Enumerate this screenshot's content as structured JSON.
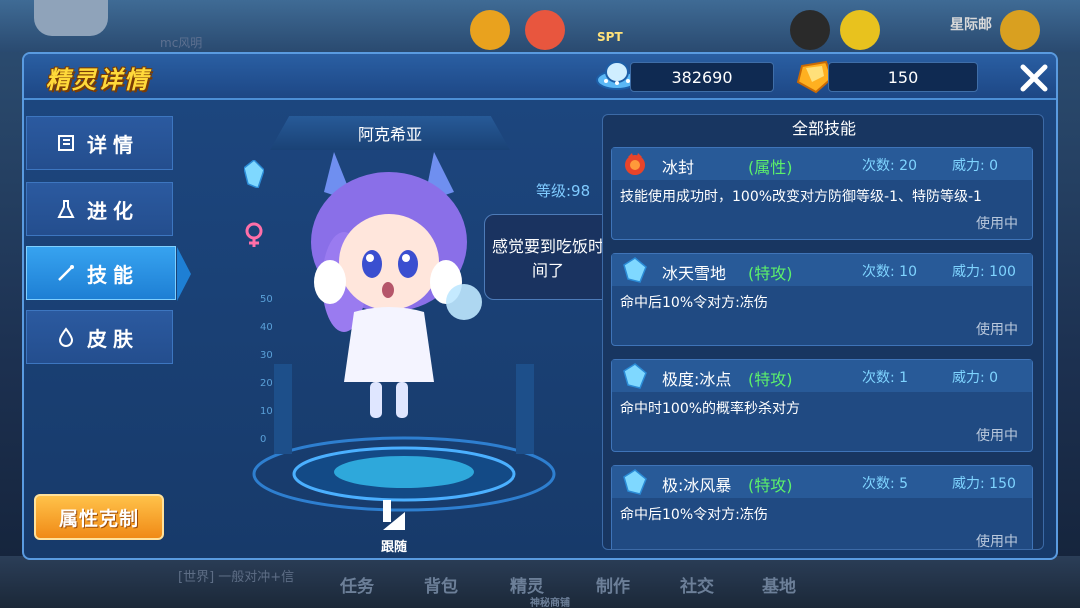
{
  "background": {
    "chat_top": "mc风明",
    "mail_label": "星际邮",
    "spt_label": "SPT",
    "chat_bottom": "[世界] 一般对冲+信",
    "bottom_nav": [
      "任务",
      "背包",
      "精灵",
      "制作",
      "社交",
      "基地"
    ],
    "bottom_sub": "神秘商铺"
  },
  "header": {
    "title": "精灵详情",
    "currency1_value": "382690",
    "currency2_value": "150",
    "close_icon": "close-icon"
  },
  "sidebar": {
    "tabs": [
      {
        "label": "详情",
        "icon": "book-icon"
      },
      {
        "label": "进化",
        "icon": "flask-icon"
      },
      {
        "label": "技能",
        "icon": "wand-icon"
      },
      {
        "label": "皮肤",
        "icon": "drop-icon"
      }
    ],
    "active_tab": "技能",
    "attribute_button": "属性克制"
  },
  "pet": {
    "name": "阿克希亚",
    "level_text": "等级:98",
    "speech": "感觉要到吃饭时间了",
    "follow_label": "跟随",
    "scale_ticks": [
      "50",
      "40",
      "30",
      "20",
      "10",
      "0"
    ]
  },
  "skills": {
    "title": "全部技能",
    "items": [
      {
        "name": "冰封",
        "type": "(属性)",
        "count": "次数: 20",
        "power": "威力: 0",
        "desc": "技能使用成功时，100%改变对方防御等级-1、特防等级-1",
        "use": "使用中",
        "icon": "fire-orb-icon"
      },
      {
        "name": "冰天雪地",
        "type": "(特攻)",
        "count": "次数: 10",
        "power": "威力: 100",
        "desc": "命中后10%令对方:冻伤",
        "use": "使用中",
        "icon": "ice-crystal-icon"
      },
      {
        "name": "极度:冰点",
        "type": "(特攻)",
        "count": "次数: 1",
        "power": "威力: 0",
        "desc": "命中时100%的概率秒杀对方",
        "use": "使用中",
        "icon": "ice-crystal-icon"
      },
      {
        "name": "极:冰风暴",
        "type": "(特攻)",
        "count": "次数: 5",
        "power": "威力: 150",
        "desc": "命中后10%令对方:冻伤",
        "use": "使用中",
        "icon": "ice-crystal-icon"
      }
    ]
  },
  "colors": {
    "accent_gold": "#ffd93a",
    "skill_type_green": "#5cf06b",
    "tab_active": "#1e7fd4"
  }
}
